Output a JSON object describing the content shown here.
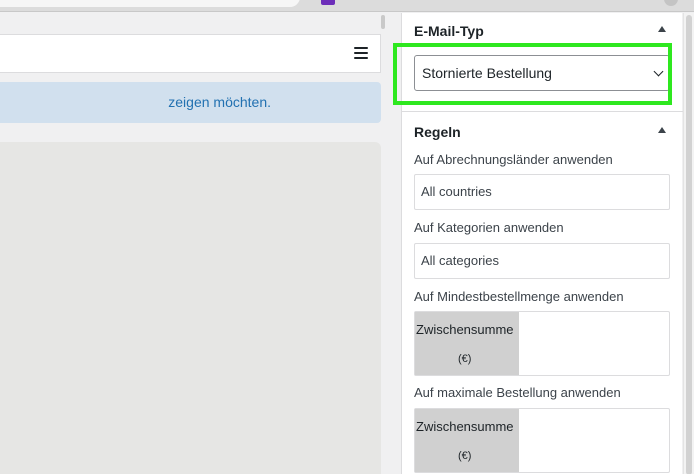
{
  "colors": {
    "accent": "#2271b1",
    "notice_bg": "#d1e0ee",
    "highlight": "#2ee81f",
    "browser_extension": "#6c2eb9"
  },
  "editor": {
    "notice_text": "zeigen möchten.",
    "menu_icon": "hamburger-icon"
  },
  "email_type_section": {
    "title": "E-Mail-Typ",
    "toggle_icon": "caret-up-icon",
    "select_value": "Stornierte Bestellung",
    "select_icon": "chevron-down-icon"
  },
  "rules_section": {
    "title": "Regeln",
    "toggle_icon": "caret-up-icon",
    "fields": [
      {
        "label": "Auf Abrechnungsländer anwenden",
        "value": "All countries"
      },
      {
        "label": "Auf Kategorien anwenden",
        "value": "All categories"
      },
      {
        "label": "Auf Mindestbestellmenge anwenden",
        "addon_line1": "Zwischensumme",
        "addon_line2": "(€)",
        "value": ""
      },
      {
        "label": "Auf maximale Bestellung anwenden",
        "addon_line1": "Zwischensumme",
        "addon_line2": "(€)",
        "value": ""
      }
    ]
  }
}
